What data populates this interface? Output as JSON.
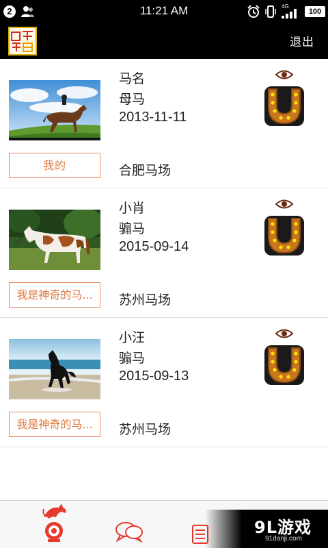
{
  "status_bar": {
    "notification_count": "2",
    "time": "11:21 AM",
    "network": "4G",
    "battery": "100",
    "icons": [
      "user-icon",
      "alarm-icon",
      "vibrate-icon",
      "signal-icon",
      "battery-icon"
    ]
  },
  "header": {
    "logo_icon": "app-logo-icon",
    "logout_label": "退出"
  },
  "horses": [
    {
      "name": "马名",
      "gender": "母马",
      "date": "2013-11-11",
      "tag": "我的",
      "farm": "合肥马场",
      "photo": "rider-on-brown-horse-photo"
    },
    {
      "name": "小肖",
      "gender": "骟马",
      "date": "2015-09-14",
      "tag": "我是神奇的马...",
      "farm": "苏州马场",
      "photo": "pinto-horse-photo"
    },
    {
      "name": "小汪",
      "gender": "骟马",
      "date": "2015-09-13",
      "tag": "我是神奇的马...",
      "farm": "苏州马场",
      "photo": "black-horse-beach-photo"
    }
  ],
  "bottom_nav": {
    "items": [
      "home-horse-icon",
      "chat-icon",
      "list-icon"
    ]
  },
  "watermark": {
    "main": "9L游戏",
    "sub": "91danji.com"
  },
  "colors": {
    "accent": "#e0773e",
    "bar": "#000000",
    "nav_active": "#e63a2e"
  }
}
